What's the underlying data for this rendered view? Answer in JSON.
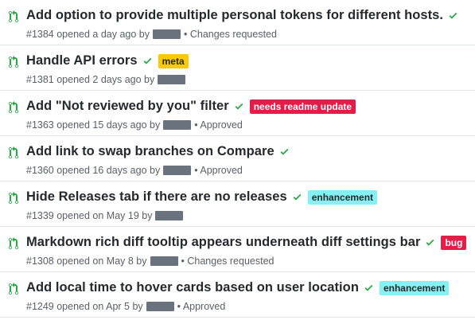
{
  "colors": {
    "pr_open_green": "#28a745",
    "check_green": "#28a745",
    "title": "#24292e",
    "meta": "#586069"
  },
  "pull_requests": [
    {
      "title": "Add option to provide multiple personal tokens for different hosts.",
      "meta": "#1384 opened a day ago by",
      "status": "• Changes requested",
      "icon": "git-pull-request-icon",
      "label": null
    },
    {
      "title": "Handle API errors",
      "meta": "#1381 opened 2 days ago by",
      "status": "",
      "icon": "git-pull-request-icon",
      "label": {
        "text": "meta",
        "bg": "#fbca04",
        "fg": "#24292e"
      }
    },
    {
      "title": "Add \"Not reviewed by you\" filter",
      "meta": "#1363 opened 15 days ago by",
      "status": "• Approved",
      "icon": "git-pull-request-icon",
      "label": {
        "text": "needs readme update",
        "bg": "#e11d48",
        "fg": "#ffffff"
      }
    },
    {
      "title": "Add link to swap branches on Compare",
      "meta": "#1360 opened 16 days ago by",
      "status": "• Approved",
      "icon": "git-pull-request-icon",
      "label": null
    },
    {
      "title": "Hide Releases tab if there are no releases",
      "meta": "#1339 opened on May 19 by",
      "status": "",
      "icon": "git-pull-request-icon",
      "label": {
        "text": "enhancement",
        "bg": "#84f1f3",
        "fg": "#24292e"
      }
    },
    {
      "title": "Markdown rich diff tooltip appears underneath diff settings bar",
      "meta": "#1308 opened on May 8 by",
      "status": "• Changes requested",
      "icon": "git-pull-request-icon",
      "label": {
        "text": "bug",
        "bg": "#e11d48",
        "fg": "#ffffff"
      }
    },
    {
      "title": "Add local time to hover cards based on user location",
      "meta": "#1249 opened on Apr 5 by",
      "status": "• Approved",
      "icon": "git-pull-request-icon",
      "label": {
        "text": "enhancement",
        "bg": "#84f1f3",
        "fg": "#24292e"
      }
    }
  ]
}
